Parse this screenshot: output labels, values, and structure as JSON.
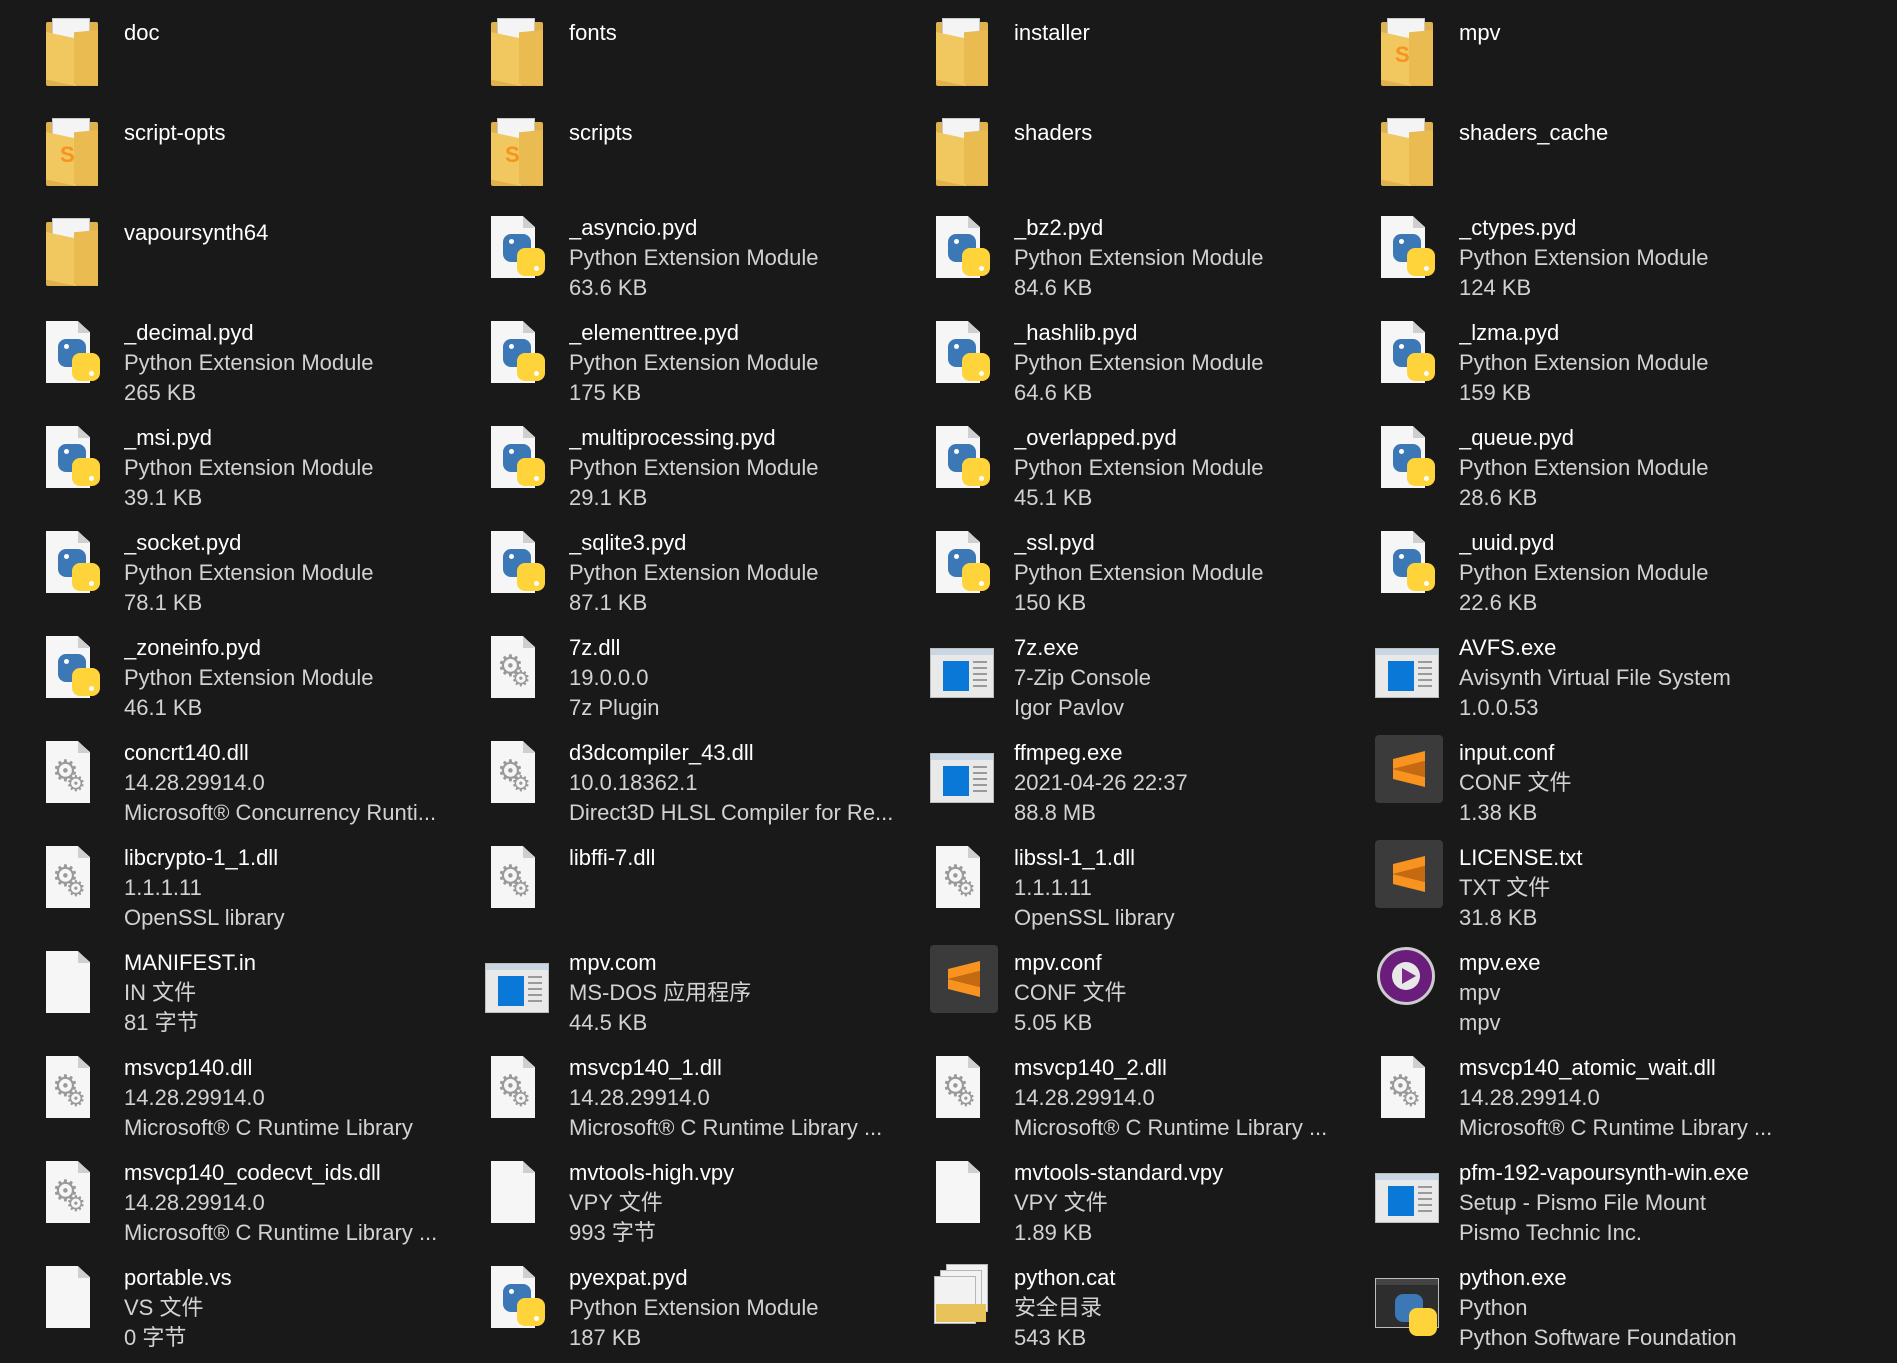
{
  "items": [
    {
      "name": "doc",
      "line2": "",
      "line3": "",
      "icon": "folder-icon"
    },
    {
      "name": "fonts",
      "line2": "",
      "line3": "",
      "icon": "folder-icon"
    },
    {
      "name": "installer",
      "line2": "",
      "line3": "",
      "icon": "folder-icon"
    },
    {
      "name": "mpv",
      "line2": "",
      "line3": "",
      "icon": "folder-icon"
    },
    {
      "name": "script-opts",
      "line2": "",
      "line3": "",
      "icon": "folder-icon"
    },
    {
      "name": "scripts",
      "line2": "",
      "line3": "",
      "icon": "folder-icon"
    },
    {
      "name": "shaders",
      "line2": "",
      "line3": "",
      "icon": "folder-icon"
    },
    {
      "name": "shaders_cache",
      "line2": "",
      "line3": "",
      "icon": "folder-icon"
    },
    {
      "name": "vapoursynth64",
      "line2": "",
      "line3": "",
      "icon": "folder-icon"
    },
    {
      "name": "_asyncio.pyd",
      "line2": "Python Extension Module",
      "line3": "63.6 KB",
      "icon": "python-file-icon"
    },
    {
      "name": "_bz2.pyd",
      "line2": "Python Extension Module",
      "line3": "84.6 KB",
      "icon": "python-file-icon"
    },
    {
      "name": "_ctypes.pyd",
      "line2": "Python Extension Module",
      "line3": "124 KB",
      "icon": "python-file-icon"
    },
    {
      "name": "_decimal.pyd",
      "line2": "Python Extension Module",
      "line3": "265 KB",
      "icon": "python-file-icon"
    },
    {
      "name": "_elementtree.pyd",
      "line2": "Python Extension Module",
      "line3": "175 KB",
      "icon": "python-file-icon"
    },
    {
      "name": "_hashlib.pyd",
      "line2": "Python Extension Module",
      "line3": "64.6 KB",
      "icon": "python-file-icon"
    },
    {
      "name": "_lzma.pyd",
      "line2": "Python Extension Module",
      "line3": "159 KB",
      "icon": "python-file-icon"
    },
    {
      "name": "_msi.pyd",
      "line2": "Python Extension Module",
      "line3": "39.1 KB",
      "icon": "python-file-icon"
    },
    {
      "name": "_multiprocessing.pyd",
      "line2": "Python Extension Module",
      "line3": "29.1 KB",
      "icon": "python-file-icon"
    },
    {
      "name": "_overlapped.pyd",
      "line2": "Python Extension Module",
      "line3": "45.1 KB",
      "icon": "python-file-icon"
    },
    {
      "name": "_queue.pyd",
      "line2": "Python Extension Module",
      "line3": "28.6 KB",
      "icon": "python-file-icon"
    },
    {
      "name": "_socket.pyd",
      "line2": "Python Extension Module",
      "line3": "78.1 KB",
      "icon": "python-file-icon"
    },
    {
      "name": "_sqlite3.pyd",
      "line2": "Python Extension Module",
      "line3": "87.1 KB",
      "icon": "python-file-icon"
    },
    {
      "name": "_ssl.pyd",
      "line2": "Python Extension Module",
      "line3": "150 KB",
      "icon": "python-file-icon"
    },
    {
      "name": "_uuid.pyd",
      "line2": "Python Extension Module",
      "line3": "22.6 KB",
      "icon": "python-file-icon"
    },
    {
      "name": "_zoneinfo.pyd",
      "line2": "Python Extension Module",
      "line3": "46.1 KB",
      "icon": "python-file-icon"
    },
    {
      "name": "7z.dll",
      "line2": "19.0.0.0",
      "line3": "7z Plugin",
      "icon": "dll-gear-icon"
    },
    {
      "name": "7z.exe",
      "line2": "7-Zip Console",
      "line3": "Igor Pavlov",
      "icon": "app-window-icon"
    },
    {
      "name": "AVFS.exe",
      "line2": "Avisynth Virtual File System",
      "line3": "1.0.0.53",
      "icon": "app-window-icon"
    },
    {
      "name": "concrt140.dll",
      "line2": "14.28.29914.0",
      "line3": "Microsoft® Concurrency Runti...",
      "icon": "dll-gear-icon"
    },
    {
      "name": "d3dcompiler_43.dll",
      "line2": "10.0.18362.1",
      "line3": "Direct3D HLSL Compiler for Re...",
      "icon": "dll-gear-icon"
    },
    {
      "name": "ffmpeg.exe",
      "line2": "2021-04-26 22:37",
      "line3": "88.8 MB",
      "icon": "app-window-icon"
    },
    {
      "name": "input.conf",
      "line2": "CONF 文件",
      "line3": "1.38 KB",
      "icon": "sublime-text-icon"
    },
    {
      "name": "libcrypto-1_1.dll",
      "line2": "1.1.1.11",
      "line3": "OpenSSL library",
      "icon": "dll-gear-icon"
    },
    {
      "name": "libffi-7.dll",
      "line2": "",
      "line3": "",
      "icon": "dll-gear-icon"
    },
    {
      "name": "libssl-1_1.dll",
      "line2": "1.1.1.11",
      "line3": "OpenSSL library",
      "icon": "dll-gear-icon"
    },
    {
      "name": "LICENSE.txt",
      "line2": "TXT 文件",
      "line3": "31.8 KB",
      "icon": "sublime-text-icon"
    },
    {
      "name": "MANIFEST.in",
      "line2": "IN 文件",
      "line3": "81 字节",
      "icon": "blank-file-icon"
    },
    {
      "name": "mpv.com",
      "line2": "MS-DOS 应用程序",
      "line3": "44.5 KB",
      "icon": "app-window-icon"
    },
    {
      "name": "mpv.conf",
      "line2": "CONF 文件",
      "line3": "5.05 KB",
      "icon": "sublime-text-icon"
    },
    {
      "name": "mpv.exe",
      "line2": "mpv",
      "line3": "mpv",
      "icon": "mpv-player-icon"
    },
    {
      "name": "msvcp140.dll",
      "line2": "14.28.29914.0",
      "line3": "Microsoft® C Runtime Library",
      "icon": "dll-gear-icon"
    },
    {
      "name": "msvcp140_1.dll",
      "line2": "14.28.29914.0",
      "line3": "Microsoft® C Runtime Library ...",
      "icon": "dll-gear-icon"
    },
    {
      "name": "msvcp140_2.dll",
      "line2": "14.28.29914.0",
      "line3": "Microsoft® C Runtime Library ...",
      "icon": "dll-gear-icon"
    },
    {
      "name": "msvcp140_atomic_wait.dll",
      "line2": "14.28.29914.0",
      "line3": "Microsoft® C Runtime Library ...",
      "icon": "dll-gear-icon"
    },
    {
      "name": "msvcp140_codecvt_ids.dll",
      "line2": "14.28.29914.0",
      "line3": "Microsoft® C Runtime Library ...",
      "icon": "dll-gear-icon"
    },
    {
      "name": "mvtools-high.vpy",
      "line2": "VPY 文件",
      "line3": "993 字节",
      "icon": "blank-file-icon"
    },
    {
      "name": "mvtools-standard.vpy",
      "line2": "VPY 文件",
      "line3": "1.89 KB",
      "icon": "blank-file-icon"
    },
    {
      "name": "pfm-192-vapoursynth-win.exe",
      "line2": "Setup - Pismo File Mount",
      "line3": "Pismo Technic Inc.",
      "icon": "app-window-icon"
    },
    {
      "name": "portable.vs",
      "line2": "VS 文件",
      "line3": "0 字节",
      "icon": "blank-file-icon"
    },
    {
      "name": "pyexpat.pyd",
      "line2": "Python Extension Module",
      "line3": "187 KB",
      "icon": "python-file-icon"
    },
    {
      "name": "python.cat",
      "line2": "安全目录",
      "line3": "543 KB",
      "icon": "security-catalog-icon"
    },
    {
      "name": "python.exe",
      "line2": "Python",
      "line3": "Python Software Foundation",
      "icon": "python-exe-icon"
    }
  ],
  "colors": {
    "background": "#191919",
    "name_text": "#ffffff",
    "detail_text": "#d2d2d2",
    "folder": "#f1c75f",
    "python_blue": "#3c78b5",
    "python_yellow": "#ffd43b",
    "sublime_orange": "#f7931e",
    "app_blue": "#0a78d7"
  }
}
